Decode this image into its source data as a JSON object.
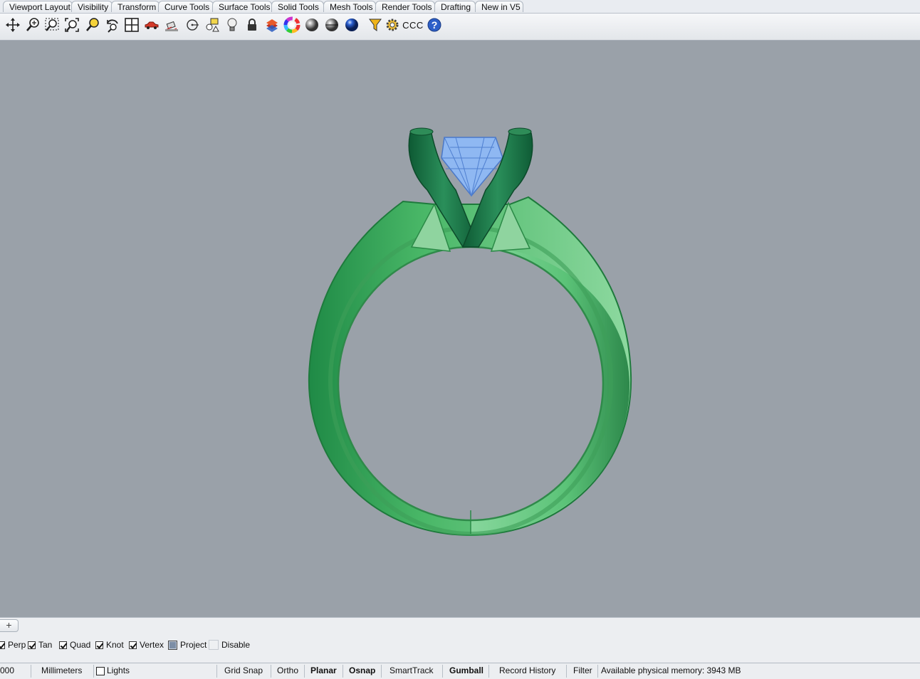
{
  "tabs": [
    {
      "label": "Viewport Layout"
    },
    {
      "label": "Visibility"
    },
    {
      "label": "Transform"
    },
    {
      "label": "Curve Tools"
    },
    {
      "label": "Surface Tools"
    },
    {
      "label": "Solid Tools"
    },
    {
      "label": "Mesh Tools"
    },
    {
      "label": "Render Tools"
    },
    {
      "label": "Drafting"
    },
    {
      "label": "New in V5"
    }
  ],
  "toolbar": {
    "icons": [
      "pan-icon",
      "zoom-icon",
      "zoom-window-icon",
      "zoom-extents-icon",
      "zoom-selected-icon",
      "rotate-view-icon",
      "four-viewports-icon",
      "car-icon",
      "camera-icon",
      "circle-snap-icon",
      "layer-shapes-icon",
      "light-bulb-icon",
      "lock-icon",
      "layers-icon",
      "color-wheel-icon",
      "shaded-sphere-icon",
      "rendered-sphere-icon",
      "material-sphere-icon",
      "filter-icon",
      "gear-icon",
      "text-ccc-icon",
      "help-icon"
    ],
    "ccc_label": "CCC"
  },
  "viewport": {
    "object": "ring-model"
  },
  "osnaps": [
    {
      "label": "Perp",
      "checked": true
    },
    {
      "label": "Tan",
      "checked": true
    },
    {
      "label": "Quad",
      "checked": true
    },
    {
      "label": "Knot",
      "checked": true
    },
    {
      "label": "Vertex",
      "checked": true
    },
    {
      "label": "Project",
      "checked": false,
      "filled": true
    },
    {
      "label": "Disable",
      "checked": false
    }
  ],
  "statusbar": {
    "coord_fragment": "000",
    "units": "Millimeters",
    "layer": "Lights",
    "grid_snap": "Grid Snap",
    "ortho": "Ortho",
    "planar": "Planar",
    "osnap": "Osnap",
    "smarttrack": "SmartTrack",
    "gumball": "Gumball",
    "record_history": "Record History",
    "filter": "Filter",
    "memory": "Available physical memory: 3943 MB"
  },
  "colors": {
    "viewport_bg": "#9aa1a9",
    "ring_green": "#5fc47a",
    "prong_green": "#1f7a4c",
    "gem_blue": "#8db6f0"
  }
}
